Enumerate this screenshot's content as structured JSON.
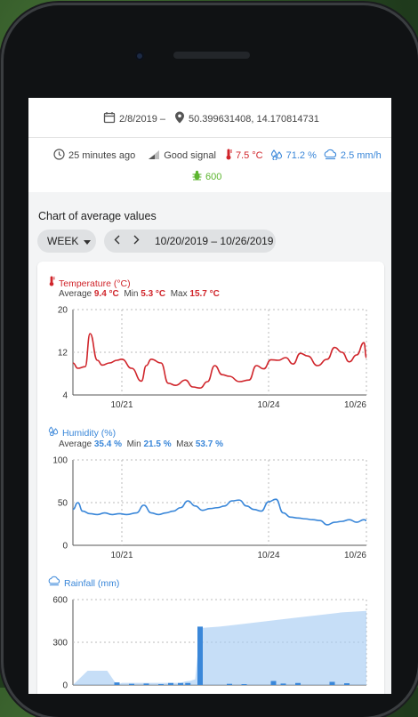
{
  "header": {
    "date": "2/8/2019 –",
    "coordinates": "50.399631408, 14.170814731"
  },
  "status": {
    "updated": "25 minutes ago",
    "signal": "Good signal",
    "temperature": "7.5 °C",
    "humidity": "71.2 %",
    "rainfall": "2.5 mm/h",
    "battery": "600"
  },
  "section_title": "Chart of average values",
  "controls": {
    "period": "WEEK",
    "range": "10/20/2019 – 10/26/2019"
  },
  "colors": {
    "temperature": "#d0252b",
    "humidity": "#3a87d9",
    "rainfall": "#a8cdf2",
    "positive": "#5cb52f"
  },
  "chart_data": [
    {
      "type": "line",
      "title": "Temperature (°C)",
      "stats": {
        "average_label": "Average",
        "average": "9.4 °C",
        "min_label": "Min",
        "min": "5.3 °C",
        "max_label": "Max",
        "max": "15.7 °C"
      },
      "ylim": [
        4,
        20
      ],
      "yticks": [
        4,
        12,
        20
      ],
      "xticks": [
        {
          "x": 1,
          "label": "10/21"
        },
        {
          "x": 4,
          "label": "10/24"
        },
        {
          "x": 6,
          "label": "10/26"
        }
      ],
      "xlim": [
        0,
        6
      ],
      "x": [
        0,
        0.1,
        0.25,
        0.35,
        0.5,
        0.6,
        0.75,
        0.9,
        1.0,
        1.2,
        1.4,
        1.5,
        1.6,
        1.8,
        1.95,
        2.1,
        2.3,
        2.45,
        2.6,
        2.75,
        2.9,
        3.05,
        3.2,
        3.4,
        3.6,
        3.75,
        3.9,
        4.05,
        4.2,
        4.35,
        4.5,
        4.65,
        4.8,
        5.0,
        5.2,
        5.35,
        5.5,
        5.65,
        5.8,
        5.95,
        6.0
      ],
      "y": [
        10,
        9,
        9.3,
        15.5,
        10.5,
        9.6,
        10,
        10.5,
        10.7,
        9,
        6.6,
        9.5,
        10.7,
        10,
        6.2,
        5.8,
        6.8,
        5.5,
        5.3,
        6.5,
        9.5,
        7.8,
        7.5,
        6.5,
        6.8,
        9.5,
        8.9,
        10.6,
        10.5,
        11,
        9.8,
        11.8,
        11.3,
        9.5,
        10.7,
        12.9,
        12,
        10.2,
        11.5,
        13.8,
        11
      ]
    },
    {
      "type": "line",
      "title": "Humidity (%)",
      "stats": {
        "average_label": "Average",
        "average": "35.4 %",
        "min_label": "Min",
        "min": "21.5 %",
        "max_label": "Max",
        "max": "53.7 %"
      },
      "ylim": [
        0,
        100
      ],
      "yticks": [
        0,
        50,
        100
      ],
      "xticks": [
        {
          "x": 1,
          "label": "10/21"
        },
        {
          "x": 4,
          "label": "10/24"
        },
        {
          "x": 6,
          "label": "10/26"
        }
      ],
      "xlim": [
        0,
        6
      ],
      "x": [
        0,
        0.1,
        0.2,
        0.35,
        0.5,
        0.65,
        0.8,
        0.95,
        1.1,
        1.3,
        1.45,
        1.6,
        1.75,
        1.9,
        2.05,
        2.2,
        2.35,
        2.5,
        2.65,
        2.8,
        2.95,
        3.1,
        3.25,
        3.4,
        3.55,
        3.7,
        3.85,
        4.0,
        4.15,
        4.3,
        4.45,
        4.6,
        4.75,
        4.9,
        5.05,
        5.2,
        5.35,
        5.5,
        5.65,
        5.8,
        5.95,
        6.0
      ],
      "y": [
        42,
        50,
        40,
        37,
        36,
        38,
        36,
        37,
        36,
        38,
        47,
        38,
        36,
        38,
        40,
        44,
        52,
        46,
        41,
        43,
        44,
        46,
        52,
        53,
        46,
        42,
        40,
        51,
        54,
        38,
        33,
        32,
        31,
        30,
        29,
        24,
        27,
        28,
        30,
        27,
        30,
        29
      ]
    },
    {
      "type": "bar",
      "title": "Rainfall (mm)",
      "ylim": [
        0,
        600
      ],
      "yticks": [
        0,
        300,
        600
      ],
      "xlim": [
        0,
        6
      ],
      "cumulative_x": [
        0,
        0.3,
        0.7,
        0.9,
        1.0,
        2.2,
        2.3,
        2.4,
        2.5,
        2.6,
        3.0,
        3.5,
        4.0,
        4.5,
        5.0,
        5.5,
        6.0
      ],
      "cumulative_y": [
        0,
        100,
        100,
        0,
        15,
        15,
        25,
        30,
        40,
        400,
        410,
        430,
        450,
        470,
        490,
        510,
        520
      ],
      "bars_x": [
        0.9,
        1.2,
        1.5,
        1.8,
        2.0,
        2.2,
        2.35,
        2.6,
        3.2,
        3.5,
        4.1,
        4.3,
        4.6,
        5.3,
        5.6
      ],
      "bars_y": [
        18,
        8,
        10,
        6,
        14,
        14,
        14,
        410,
        8,
        6,
        28,
        10,
        14,
        22,
        12
      ]
    }
  ]
}
